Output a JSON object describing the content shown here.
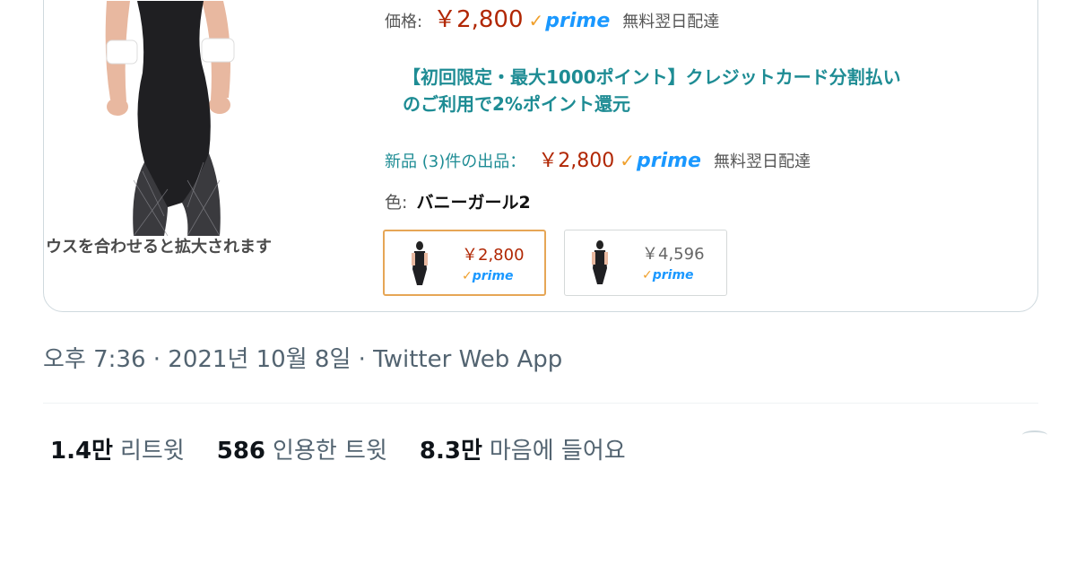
{
  "product": {
    "price_label": "価格:",
    "price": "￥2,800",
    "prime_badge": "prime",
    "shipping": "無料翌日配達",
    "promo_line1": "【初回限定・最大1000ポイント】クレジットカード分割払い",
    "promo_line2": "のご利用で2%ポイント還元",
    "offers_label": "新品 (3)件の出品：",
    "offers_price": "￥2,800",
    "offers_prime": "prime",
    "offers_shipping": "無料翌日配達",
    "color_label": "色:",
    "color_value": "バニーガール2",
    "zoom_hint": "ウスを合わせると拡大されます",
    "swatches": [
      {
        "price": "￥2,800",
        "prime": "prime"
      },
      {
        "price": "￥4,596",
        "prime": "prime"
      }
    ]
  },
  "tweet": {
    "timestamp": "오후 7:36 · 2021년 10월 8일 · Twitter Web App",
    "stats": [
      {
        "count": "1.4만",
        "label": "리트윗"
      },
      {
        "count": "586",
        "label": "인용한 트윗"
      },
      {
        "count": "8.3만",
        "label": "마음에 들어요"
      }
    ]
  },
  "colors": {
    "price_red": "#b12704",
    "link_teal": "#1e8c94",
    "prime_blue": "#1a98ff",
    "prime_check": "#f0a02c",
    "meta_gray": "#536471"
  }
}
